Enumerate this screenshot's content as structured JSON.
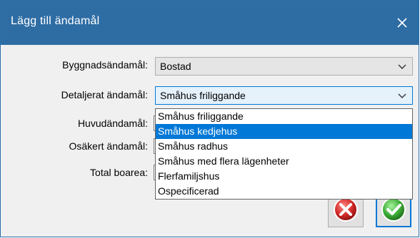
{
  "window": {
    "title": "Lägg till ändamål"
  },
  "fields": {
    "byggnad": {
      "label": "Byggnadsändamål:",
      "value": "Bostad"
    },
    "detaljerat": {
      "label": "Detaljerat ändamål:",
      "value": "Småhus friliggande"
    },
    "huvud": {
      "label": "Huvudändamål:"
    },
    "osakert": {
      "label": "Osäkert ändamål:"
    },
    "total": {
      "label": "Total boarea:"
    }
  },
  "dropdown": {
    "options": [
      "Småhus friliggande",
      "Småhus kedjehus",
      "Småhus radhus",
      "Småhus med flera lägenheter",
      "Flerfamiljshus",
      "Ospecificerad"
    ],
    "highlighted_option": "Småhus kedjehus"
  },
  "colors": {
    "titlebar": "#2e6da4",
    "selection": "#0078d7",
    "cancel": "#d42a2a",
    "ok": "#3fae3a"
  },
  "icons": {
    "close": "close-icon",
    "cancel": "red-x-circle-icon",
    "ok": "green-check-circle-icon",
    "combo_arrow": "chevron-down-icon"
  }
}
